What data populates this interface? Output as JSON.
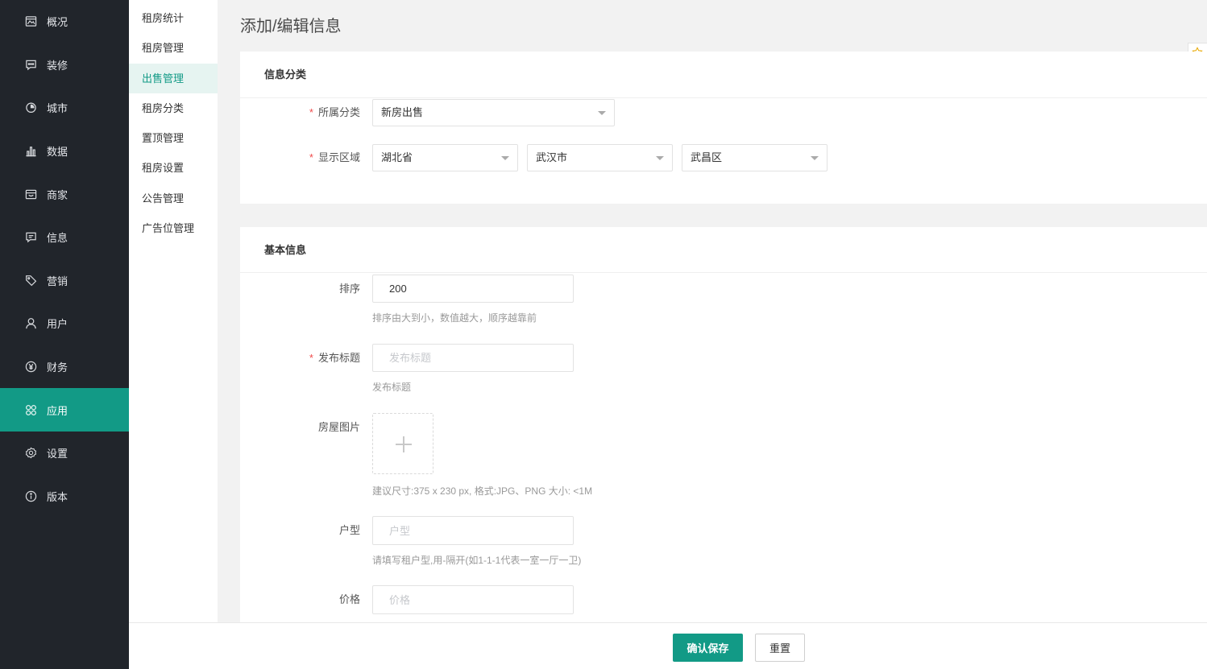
{
  "colors": {
    "accent": "#129a86",
    "sidebar_bg": "#21252b",
    "subnav_active_bg": "#e6f4f1",
    "page_bg": "#f2f2f2",
    "star": "#e8a800"
  },
  "sidebar": {
    "items": [
      {
        "label": "概况",
        "icon": "image-icon"
      },
      {
        "label": "装修",
        "icon": "message-square-icon"
      },
      {
        "label": "城市",
        "icon": "pie-clock-icon"
      },
      {
        "label": "数据",
        "icon": "bar-chart-icon"
      },
      {
        "label": "商家",
        "icon": "store-card-icon"
      },
      {
        "label": "信息",
        "icon": "chat-icon"
      },
      {
        "label": "营销",
        "icon": "tag-icon"
      },
      {
        "label": "用户",
        "icon": "user-icon"
      },
      {
        "label": "财务",
        "icon": "yen-circle-icon"
      },
      {
        "label": "应用",
        "icon": "apps-icon",
        "active": true
      },
      {
        "label": "设置",
        "icon": "gear-icon"
      },
      {
        "label": "版本",
        "icon": "info-circle-icon"
      }
    ]
  },
  "subnav": {
    "items": [
      {
        "label": "租房统计"
      },
      {
        "label": "租房管理"
      },
      {
        "label": "出售管理",
        "active": true
      },
      {
        "label": "租房分类"
      },
      {
        "label": "置顶管理"
      },
      {
        "label": "租房设置"
      },
      {
        "label": "公告管理"
      },
      {
        "label": "广告位管理"
      }
    ]
  },
  "page": {
    "title": "添加/编辑信息"
  },
  "form": {
    "required_mark": "*"
  },
  "category_card": {
    "title": "信息分类",
    "category": {
      "label": "所属分类",
      "value": "新房出售"
    },
    "region": {
      "label": "显示区域",
      "province": "湖北省",
      "city": "武汉市",
      "district": "武昌区"
    }
  },
  "basic_card": {
    "title": "基本信息",
    "sort": {
      "label": "排序",
      "value": "200",
      "help": "排序由大到小，数值越大，顺序越靠前"
    },
    "post_title": {
      "label": "发布标题",
      "placeholder": "发布标题",
      "help": "发布标题"
    },
    "house_image": {
      "label": "房屋图片",
      "help": "建议尺寸:375 x 230 px, 格式:JPG、PNG 大小: <1M"
    },
    "layout": {
      "label": "户型",
      "placeholder": "户型",
      "help": "请填写租户型,用-隔开(如1-1-1代表一室一厅一卫)"
    },
    "price": {
      "label": "价格",
      "placeholder": "价格"
    }
  },
  "footer": {
    "save_label": "确认保存",
    "reset_label": "重置"
  },
  "floating": {
    "icon": "star-icon"
  }
}
